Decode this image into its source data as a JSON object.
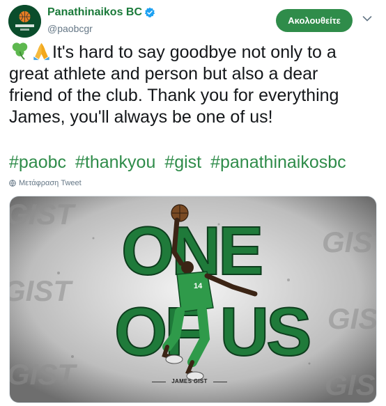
{
  "account": {
    "display_name": "Panathinaikos BC",
    "handle": "@paobcgr",
    "avatar_icon": "panathinaikos-logo",
    "verified_icon": "verified-badge-icon"
  },
  "header": {
    "follow_label": "Ακολουθείτε",
    "menu_icon": "chevron-down-icon"
  },
  "tweet": {
    "emojis": [
      "shamrock",
      "folded-hands"
    ],
    "text_lines": [
      "It's hard to say goodbye not only to a",
      "great athlete and person but also a dear",
      "friend of the club. Thank you for everything",
      "James, you'll always be one of us!"
    ],
    "hashtags": [
      "#paobc",
      "#thankyou",
      "#gist",
      "#panathinaikosbc"
    ],
    "translate_label": "Μετάφραση Tweet"
  },
  "media": {
    "headline_1": "ONE",
    "headline_2": "OF US",
    "jersey_number": "14",
    "caption": "JAMES GIST",
    "background_word": "GIST"
  },
  "colors": {
    "brand_green": "#2f8c4a",
    "name_green": "#1b7a3a",
    "dark_green": "#0b4d2c",
    "verified_blue": "#1da1f2"
  }
}
